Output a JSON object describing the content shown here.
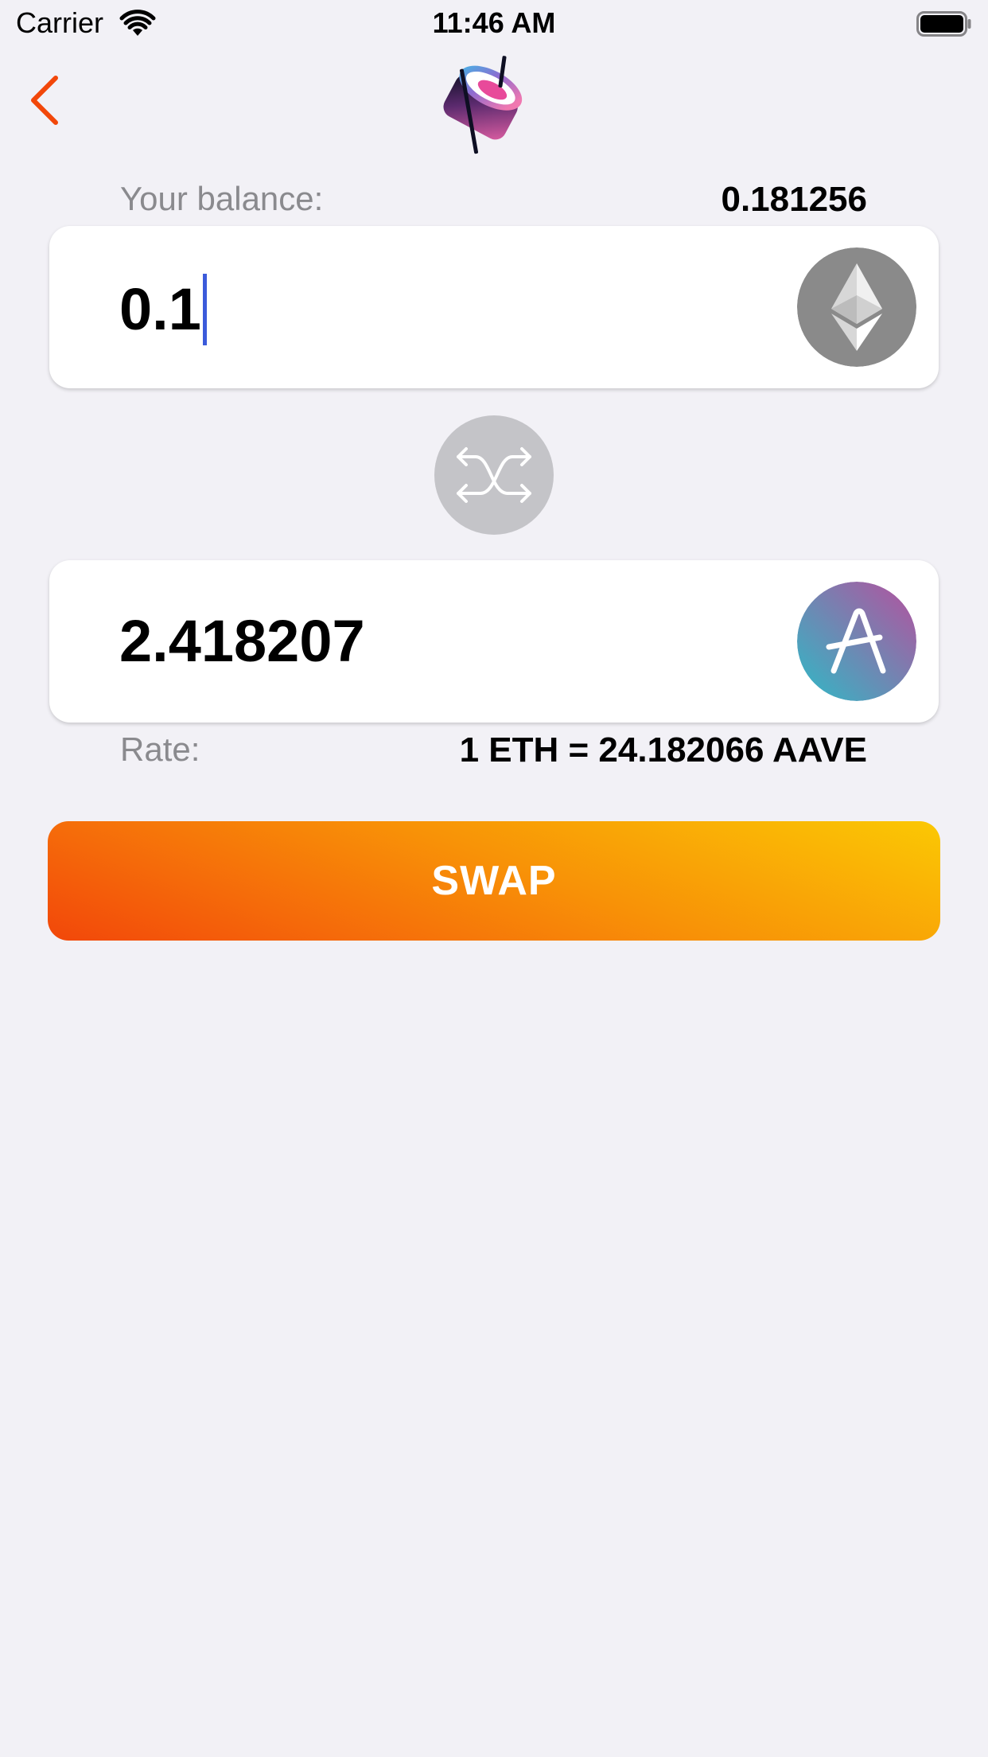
{
  "status_bar": {
    "carrier": "Carrier",
    "time": "11:46 AM",
    "wifi_icon": "wifi-icon",
    "battery_icon": "battery-full-icon"
  },
  "nav": {
    "back_icon": "chevron-left-icon",
    "logo_icon": "sushi-logo-icon",
    "accent_color": "#f2470a"
  },
  "balance": {
    "label": "Your balance:",
    "value": "0.181256"
  },
  "from": {
    "amount": "0.1",
    "token_icon": "ethereum-icon",
    "token_color": "#8a8a8a"
  },
  "switch": {
    "icon": "swap-arrows-icon"
  },
  "to": {
    "amount": "2.418207",
    "token_icon": "aave-icon"
  },
  "rate": {
    "label": "Rate:",
    "value": "1 ETH = 24.182066 AAVE"
  },
  "swap_button": {
    "label": "SWAP",
    "gradient_colors": [
      "#fbc804",
      "#f2470a"
    ]
  }
}
